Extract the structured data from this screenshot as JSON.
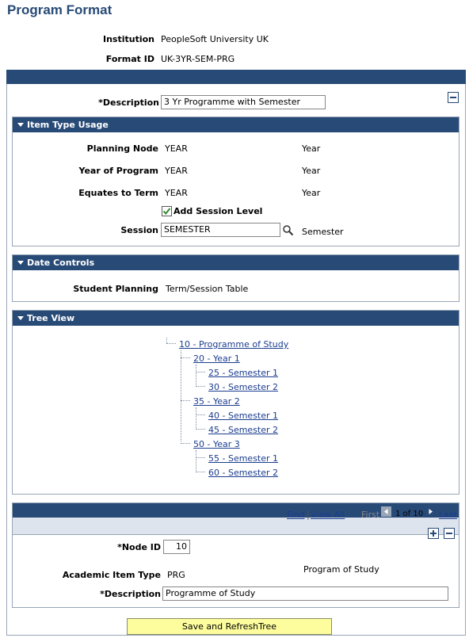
{
  "page": {
    "title": "Program Format"
  },
  "header": {
    "institution_label": "Institution",
    "institution_value": "PeopleSoft University UK",
    "format_id_label": "Format ID",
    "format_id_value": "UK-3YR-SEM-PRG"
  },
  "description": {
    "label": "*Description",
    "value": "3 Yr Programme with Semester"
  },
  "item_type_usage": {
    "title": "Item Type Usage",
    "rows": [
      {
        "label": "Planning Node",
        "code": "YEAR",
        "desc": "Year"
      },
      {
        "label": "Year of Program",
        "code": "YEAR",
        "desc": "Year"
      },
      {
        "label": "Equates to Term",
        "code": "YEAR",
        "desc": "Year"
      }
    ],
    "add_session_label": "Add Session Level",
    "add_session_checked": true,
    "session_label": "Session",
    "session_value": "SEMESTER",
    "session_desc": "Semester"
  },
  "date_controls": {
    "title": "Date Controls",
    "student_planning_label": "Student Planning",
    "student_planning_value": "Term/Session Table"
  },
  "tree_view": {
    "title": "Tree View",
    "nodes": [
      "10 - Programme of Study",
      "20 - Year 1",
      "25 - Semester 1",
      "30 - Semester 2",
      "35 - Year 2",
      "40 - Semester 1",
      "45 - Semester 2",
      "50 - Year 3",
      "55 - Semester 1",
      "60 - Semester 2"
    ]
  },
  "node_grid": {
    "find_label": "Find",
    "view_all_label": "View All",
    "first_label": "First",
    "range_label": "1 of 10",
    "last_label": "Last",
    "node_id_label": "*Node ID",
    "node_id_value": "10",
    "academic_item_type_label": "Academic Item Type",
    "academic_item_type_value": "PRG",
    "academic_item_type_desc": "Program of Study",
    "description_label": "*Description",
    "description_value": "Programme of Study"
  },
  "save_button": {
    "label": "Save and RefreshTree"
  },
  "colors": {
    "header_bar": "#284a77",
    "link": "#1b3d8f",
    "button": "#fdfd9e"
  }
}
